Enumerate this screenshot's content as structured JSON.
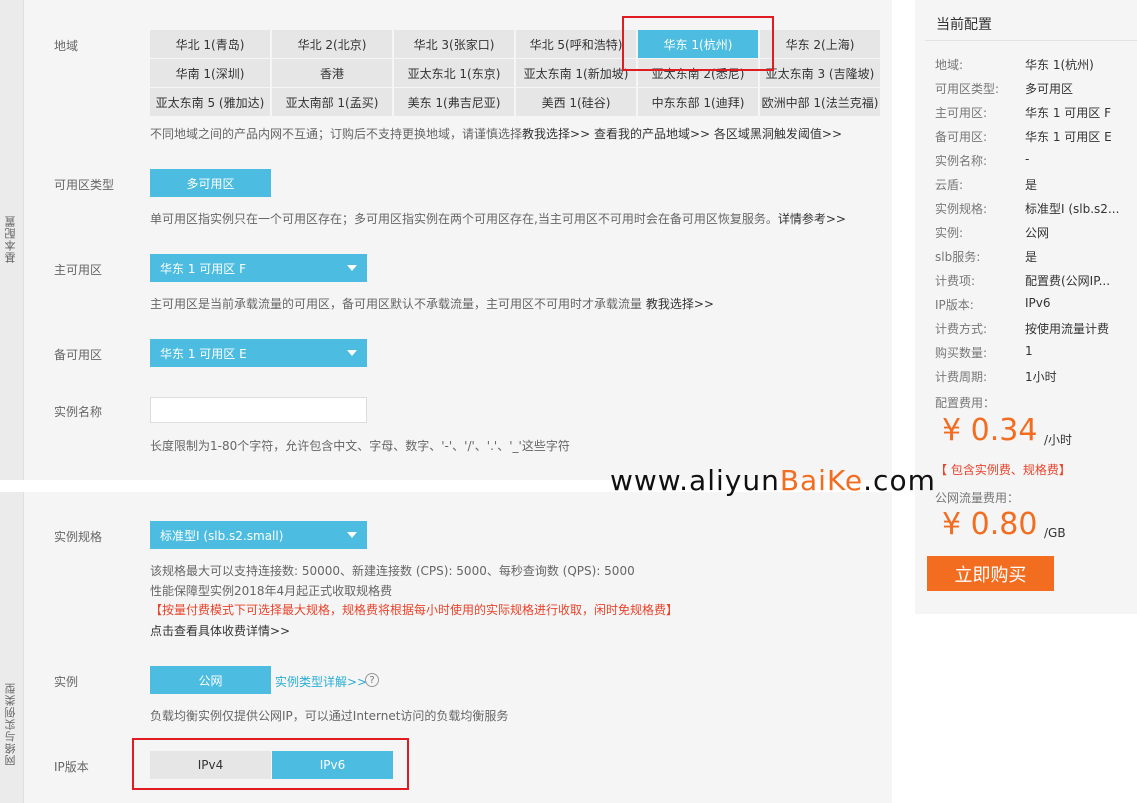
{
  "tabs": {
    "basic": "基本配置",
    "network": "网络与实例类型"
  },
  "labels": {
    "region": "地域",
    "zone_type": "可用区类型",
    "primary_zone": "主可用区",
    "backup_zone": "备可用区",
    "instance_name": "实例名称",
    "spec": "实例规格",
    "instance": "实例",
    "ip_version": "IP版本"
  },
  "regions": [
    "华北 1(青岛)",
    "华北 2(北京)",
    "华北 3(张家口)",
    "华北 5(呼和浩特)",
    "华东 1(杭州)",
    "华东 2(上海)",
    "华南 1(深圳)",
    "香港",
    "亚太东北 1(东京)",
    "亚太东南 1(新加坡)",
    "亚太东南 2(悉尼)",
    "亚太东南 3 (吉隆坡)",
    "亚太东南 5 (雅加达)",
    "亚太南部 1(孟买)",
    "美东 1(弗吉尼亚)",
    "美西 1(硅谷)",
    "中东东部 1(迪拜)",
    "欧洲中部 1(法兰克福)"
  ],
  "region_hint": {
    "text": "不同地域之间的产品内网不互通；订购后不支持更换地域，请谨慎选择",
    "link1": "教我选择>>",
    "link2": "查看我的产品地域>>",
    "link3": "各区域黑洞触发阈值>>"
  },
  "zone_type": {
    "button": "多可用区",
    "hint": "单可用区指实例只在一个可用区存在；多可用区指实例在两个可用区存在,当主可用区不可用时会在备可用区恢复服务。",
    "link": "详情参考>>"
  },
  "primary_zone": {
    "value": "华东 1 可用区 F",
    "hint": "主可用区是当前承载流量的可用区，备可用区默认不承载流量，主可用区不可用时才承载流量",
    "link": "教我选择>>"
  },
  "backup_zone": {
    "value": "华东 1 可用区 E"
  },
  "instance_name": {
    "value": "",
    "hint": "长度限制为1-80个字符，允许包含中文、字母、数字、'-'、'/'、'.'、'_'这些字符"
  },
  "spec": {
    "value": "标准型I (slb.s2.small)",
    "line1": "该规格最大可以支持连接数: 50000、新建连接数 (CPS): 5000、每秒查询数 (QPS): 5000",
    "line2": "性能保障型实例2018年4月起正式收取规格费",
    "warning": "【按量付费模式下可选择最大规格，规格费将根据每小时使用的实际规格进行收取，闲时免规格费】",
    "link": "点击查看具体收费详情>>"
  },
  "instance": {
    "button": "公网",
    "link": "实例类型详解>>",
    "help": "?",
    "hint": "负载均衡实例仅提供公网IP，可以通过Internet访问的负载均衡服务"
  },
  "ip_version": {
    "options": [
      "IPv4",
      "IPv6"
    ],
    "selected": "IPv6"
  },
  "watermark": {
    "prefix": "www.aliyun",
    "accent": "BaiKe",
    "suffix": ".com"
  },
  "sidebar": {
    "title": "当前配置",
    "rows": [
      {
        "k": "地域:",
        "v": "华东 1(杭州)"
      },
      {
        "k": "可用区类型:",
        "v": "多可用区"
      },
      {
        "k": "主可用区:",
        "v": "华东 1 可用区 F"
      },
      {
        "k": "备可用区:",
        "v": "华东 1 可用区 E"
      },
      {
        "k": "实例名称:",
        "v": "-"
      },
      {
        "k": "云盾:",
        "v": "是"
      },
      {
        "k": "实例规格:",
        "v": "标准型I (slb.s2..."
      },
      {
        "k": "实例:",
        "v": "公网"
      },
      {
        "k": "slb服务:",
        "v": "是"
      },
      {
        "k": "计费项:",
        "v": "配置费(公网IP..."
      },
      {
        "k": "IP版本:",
        "v": "IPv6"
      },
      {
        "k": "计费方式:",
        "v": "按使用流量计费"
      },
      {
        "k": "购买数量:",
        "v": "1"
      },
      {
        "k": "计费周期:",
        "v": "1小时"
      }
    ],
    "config_fee_label": "配置费用：",
    "config_price": "¥ 0.34",
    "config_unit": "/小时",
    "config_note": "【 包含实例费、规格费】",
    "traffic_fee_label": "公网流量费用：",
    "traffic_price": "¥ 0.80",
    "traffic_unit": "/GB",
    "buy_button": "立即购买"
  },
  "colors": {
    "accent_blue": "#4cbde0",
    "accent_orange": "#f36d21",
    "highlight_red": "#e01c22"
  }
}
